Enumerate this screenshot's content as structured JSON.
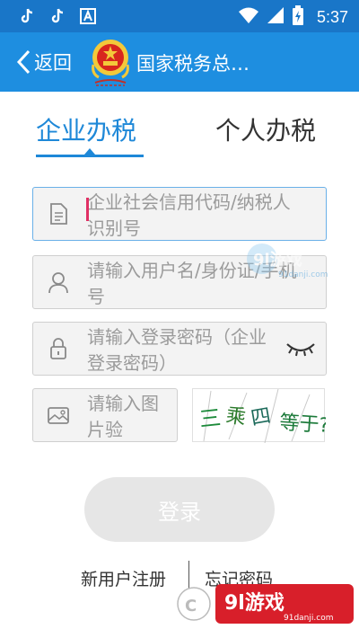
{
  "status_bar": {
    "time": "5:37",
    "left_icons": [
      "tiktok-icon",
      "tiktok-icon",
      "a-icon"
    ],
    "right_icons": [
      "wifi-icon",
      "signal-icon",
      "battery-icon"
    ]
  },
  "app_bar": {
    "back_label": "返回",
    "title": "国家税务总…",
    "background": "#1e8ee0"
  },
  "tabs": [
    {
      "label": "企业办税",
      "active": true
    },
    {
      "label": "个人办税",
      "active": false
    }
  ],
  "accent_color": "#1e88d8",
  "form": {
    "credit_code": {
      "placeholder": "企业社会信用代码/纳税人识别号",
      "icon": "document-icon"
    },
    "username": {
      "placeholder": "请输入用户名/身份证/手机号",
      "icon": "person-icon"
    },
    "password": {
      "placeholder": "请输入登录密码（企业登录密码）",
      "icon": "lock-icon",
      "toggle_icon": "eye-closed-icon"
    },
    "captcha_input": {
      "placeholder": "请输入图片验",
      "icon": "image-icon"
    },
    "captcha_image_text": "三乘四 等于?"
  },
  "login_button": "登录",
  "links": {
    "register": "新用户注册",
    "forgot": "忘记密码"
  },
  "watermark": {
    "small": "9l游戏",
    "small_domain": "91danji.com",
    "logo": "9l游戏",
    "logo_domain": "91danji.com"
  }
}
